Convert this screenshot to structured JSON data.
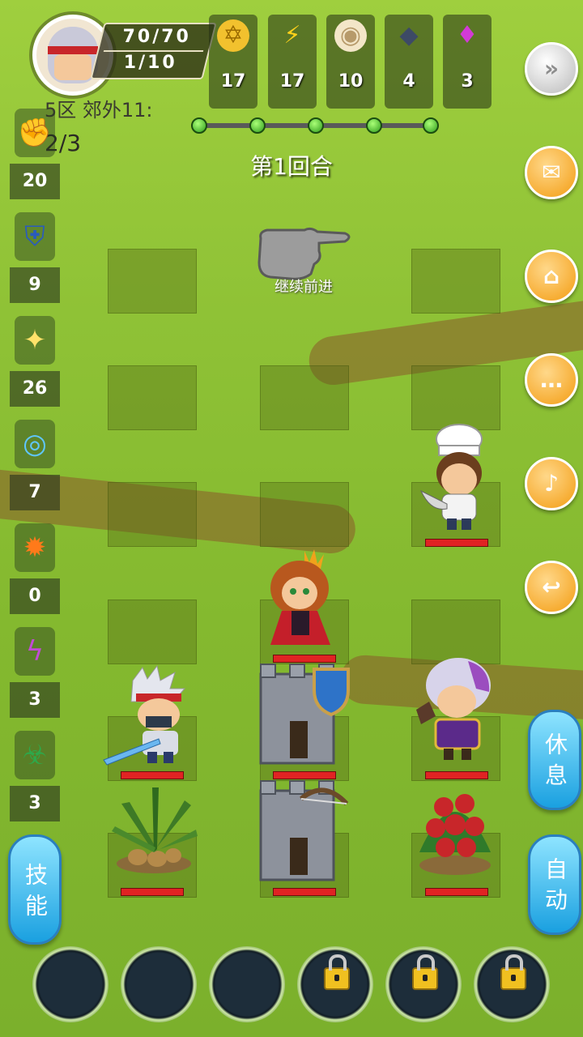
{
  "hud": {
    "hp": "70/70",
    "energy": "1/10",
    "resources": [
      {
        "name": "gold",
        "icon": "gold-coin-icon",
        "value": "17"
      },
      {
        "name": "stamina",
        "icon": "lightning-icon",
        "value": "17"
      },
      {
        "name": "bun",
        "icon": "bun-icon",
        "value": "10"
      },
      {
        "name": "ore",
        "icon": "ore-icon",
        "value": "4"
      },
      {
        "name": "gem",
        "icon": "crystal-icon",
        "value": "3"
      }
    ],
    "area_label": "5区 郊外11:",
    "wave": "2/3",
    "round": "第1回合",
    "progress_done": 5,
    "progress_total": 5
  },
  "skills": [
    {
      "icon": "fist-icon",
      "value": "20"
    },
    {
      "icon": "shield-icon",
      "value": "9"
    },
    {
      "icon": "holy-flame-icon",
      "value": "26"
    },
    {
      "icon": "water-orb-icon",
      "value": "7"
    },
    {
      "icon": "fireball-icon",
      "value": "0"
    },
    {
      "icon": "lightning-bolt-icon",
      "value": "3"
    },
    {
      "icon": "poison-icon",
      "value": "3"
    }
  ],
  "right_buttons": [
    {
      "name": "fast-forward-button",
      "icon": "fast-forward-icon",
      "glyph": "»"
    },
    {
      "name": "mail-button",
      "icon": "mail-icon",
      "glyph": "✉"
    },
    {
      "name": "home-button",
      "icon": "home-icon",
      "glyph": "⌂"
    },
    {
      "name": "chat-button",
      "icon": "chat-icon",
      "glyph": "…"
    },
    {
      "name": "sound-button",
      "icon": "speaker-icon",
      "glyph": "♪"
    },
    {
      "name": "back-button",
      "icon": "return-icon",
      "glyph": "↩"
    }
  ],
  "actions": {
    "rest": "休息",
    "auto": "自动",
    "skill": "技能",
    "continue": "继续前进"
  },
  "units": [
    {
      "name": "chef-enemy",
      "label": "chef"
    },
    {
      "name": "princess-unit",
      "label": "princess"
    },
    {
      "name": "hero-unit",
      "label": "hero"
    },
    {
      "name": "guard-tower",
      "label": "tower"
    },
    {
      "name": "mage-enemy",
      "label": "mage"
    },
    {
      "name": "plant-unit",
      "label": "plant"
    },
    {
      "name": "archer-tower",
      "label": "tower"
    },
    {
      "name": "tomato-plant-unit",
      "label": "tomato"
    }
  ],
  "bottom_slots": [
    {
      "locked": false
    },
    {
      "locked": false
    },
    {
      "locked": false
    },
    {
      "locked": true
    },
    {
      "locked": true
    },
    {
      "locked": true
    }
  ]
}
